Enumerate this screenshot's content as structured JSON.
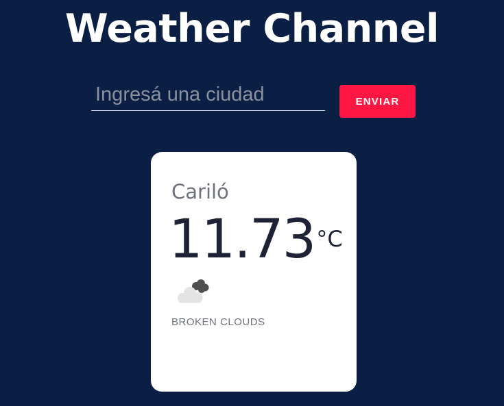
{
  "header": {
    "title": "Weather Channel"
  },
  "search": {
    "placeholder": "Ingresá una ciudad",
    "value": "",
    "submit_label": "ENVIAR"
  },
  "weather_card": {
    "city": "Cariló",
    "temperature": "11.73",
    "unit": "°C",
    "icon": "broken-clouds-icon",
    "description": "BROKEN CLOUDS"
  },
  "colors": {
    "background": "#0b1f44",
    "accent": "#ff1744",
    "card": "#ffffff"
  }
}
